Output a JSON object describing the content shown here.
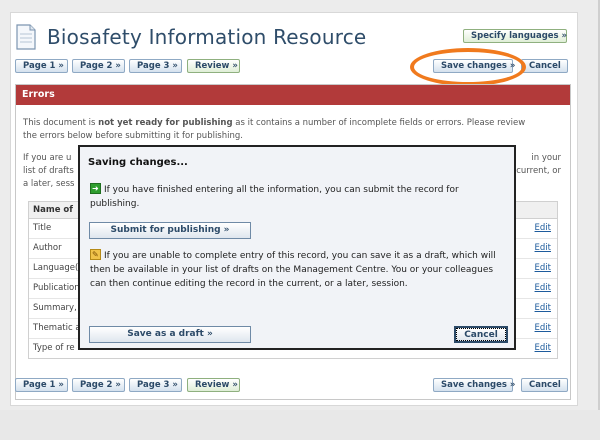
{
  "header": {
    "title": "Biosafety Information Resource",
    "specify_languages": "Specify languages »"
  },
  "top_nav": {
    "page1": "Page 1 »",
    "page2": "Page 2 »",
    "page3": "Page 3 »",
    "review": "Review »",
    "save_changes": "Save changes »",
    "cancel": "Cancel"
  },
  "errors": {
    "heading": "Errors",
    "line1_prefix": "This document is ",
    "line1_bold": "not yet ready for publishing",
    "line1_suffix": " as it contains a number of incomplete fields or errors. Please review",
    "line2": "the errors below before submitting it for publishing.",
    "para2_line1_left": "If you are u",
    "para2_line1_right": "in your",
    "para2_line2_left": "list of drafts",
    "para2_line2_right": "current, or",
    "para2_line3_left": "a later, sess",
    "table_header": "Name of",
    "rows": [
      "Title",
      "Author",
      "Language(",
      "Publication",
      "Summary,",
      "Thematic a",
      "Type of re"
    ],
    "edit_label": "Edit"
  },
  "dialog": {
    "title": "Saving changes...",
    "text1": "If you have finished entering all the information, you can submit the record for publishing.",
    "submit_button": "Submit for publishing »",
    "text2": "If you are unable to complete entry of this record, you can save it as a draft, which will then be available in your list of drafts on the Management Centre. You or your colleagues can then continue editing the record in the current, or a later, session.",
    "save_draft_button": "Save as a draft »",
    "cancel_button": "Cancel"
  },
  "bottom_nav": {
    "page1": "Page 1 »",
    "page2": "Page 2 »",
    "page3": "Page 3 »",
    "review": "Review »",
    "save_changes": "Save changes »",
    "cancel": "Cancel"
  },
  "colors": {
    "title": "#2f4d6a",
    "error_header": "#b23a3a",
    "highlight_ring": "#f07a1e"
  },
  "icons": {
    "document": "document-icon",
    "green_arrow": "arrow-right-icon",
    "pencil": "pencil-icon"
  }
}
